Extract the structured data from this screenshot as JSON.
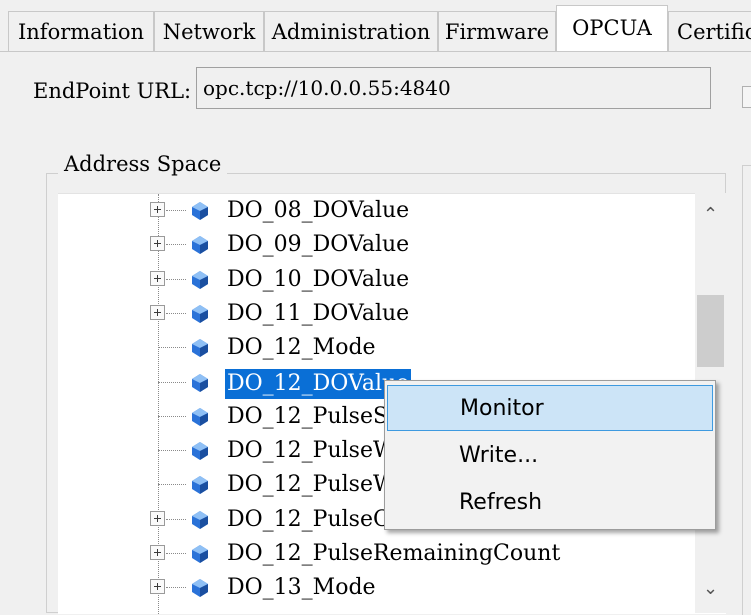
{
  "tabs": [
    {
      "label": "Information",
      "active": false
    },
    {
      "label": "Network",
      "active": false
    },
    {
      "label": "Administration",
      "active": false
    },
    {
      "label": "Firmware",
      "active": false
    },
    {
      "label": "OPCUA",
      "active": true
    },
    {
      "label": "Certific",
      "active": false
    }
  ],
  "endpoint": {
    "label": "EndPoint URL:",
    "value": "opc.tcp://10.0.0.55:4840"
  },
  "address_space": {
    "title": "Address Space",
    "nodes": [
      {
        "label": "DO_08_DOValue",
        "expandable": true
      },
      {
        "label": "DO_09_DOValue",
        "expandable": true
      },
      {
        "label": "DO_10_DOValue",
        "expandable": true
      },
      {
        "label": "DO_11_DOValue",
        "expandable": true
      },
      {
        "label": "DO_12_Mode",
        "expandable": false
      },
      {
        "label": "DO_12_DOValue",
        "expandable": false,
        "selected": true
      },
      {
        "label": "DO_12_PulseSt",
        "expandable": false
      },
      {
        "label": "DO_12_PulseW",
        "expandable": false
      },
      {
        "label": "DO_12_PulseW",
        "expandable": false
      },
      {
        "label": "DO_12_PulseO",
        "expandable": true
      },
      {
        "label": "DO_12_PulseRemainingCount",
        "expandable": true
      },
      {
        "label": "DO_13_Mode",
        "expandable": true
      }
    ],
    "icon": "node-variable-icon",
    "icon_color": "#2a72d8"
  },
  "context_menu": {
    "items": [
      {
        "label": "Monitor",
        "highlighted": true
      },
      {
        "label": "Write...",
        "highlighted": false
      },
      {
        "label": "Refresh",
        "highlighted": false
      }
    ]
  },
  "colors": {
    "selection": "#0a6fd6",
    "menu_highlight": "#cce4f7"
  }
}
